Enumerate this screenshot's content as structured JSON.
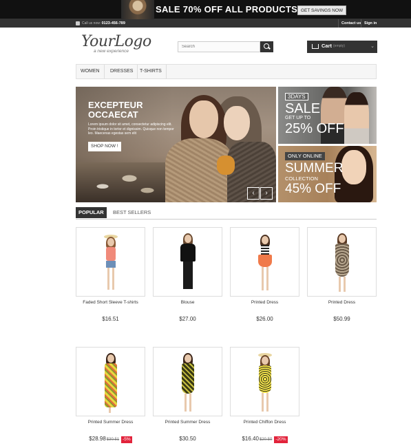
{
  "promo": {
    "headline": "SALE 70% OFF ALL PRODUCTS",
    "button": "GET SAVINGS NOW"
  },
  "topbar": {
    "call_label": "Call us now:",
    "phone": "0123-456-789",
    "contact_us": "Contact us",
    "sign_in": "Sign in"
  },
  "header": {
    "logo_main": "YourLogo",
    "logo_sub": "a new experience",
    "search_placeholder": "Search",
    "cart_label": "Cart",
    "cart_status": "(empty)"
  },
  "menu": [
    {
      "label": "WOMEN"
    },
    {
      "label": "DRESSES"
    },
    {
      "label": "T-SHIRTS"
    }
  ],
  "hero": {
    "title": "EXCEPTEUR OCCAECAT",
    "text": "Lorem ipsum dolor sit amet, consectetur adipiscing elit. Proin tristique in tortor et dignissim. Quisque non tempor leo. Maecenas egestas sem elit",
    "button": "SHOP NOW !"
  },
  "side_banners": {
    "one": {
      "tag": "3DAYS",
      "big": "SALE",
      "small": "GET UP TO",
      "off": "25% OFF"
    },
    "two": {
      "tag": "ONLY ONLINE",
      "big": "SUMMER",
      "small": "COLLECTION",
      "off": "45% OFF"
    }
  },
  "tabs": {
    "popular": "POPULAR",
    "best_sellers": "BEST SELLERS"
  },
  "products": [
    {
      "name": "Faded Short Sleeve T-shirts",
      "price": "$16.51"
    },
    {
      "name": "Blouse",
      "price": "$27.00"
    },
    {
      "name": "Printed Dress",
      "price": "$26.00"
    },
    {
      "name": "Printed Dress",
      "price": "$50.99"
    },
    {
      "name": "Printed Summer Dress",
      "price": "$28.98",
      "old_price": "$30.51",
      "discount": "-5%"
    },
    {
      "name": "Printed Summer Dress",
      "price": "$30.50"
    },
    {
      "name": "Printed Chiffon Dress",
      "price": "$16.40",
      "old_price": "$20.50",
      "discount": "-20%"
    }
  ]
}
